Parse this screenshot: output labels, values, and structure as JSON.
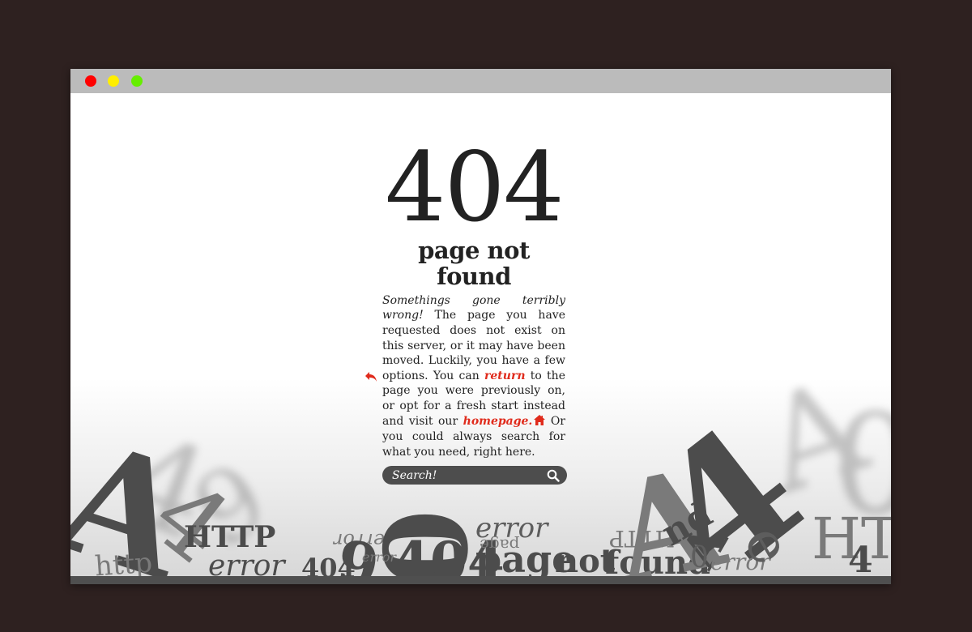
{
  "window": {
    "controls": {
      "close_color": "#ff0000",
      "minimize_color": "#ffee00",
      "maximize_color": "#66ee00"
    }
  },
  "error": {
    "code": "404",
    "title": "page not found",
    "lead": "Somethings gone terribly wrong!",
    "body_part1": " The page you have requested does not exist on this server, or it may have been moved. Luckily, you have a few options. You can ",
    "return_link": "return",
    "body_part2": " to the page you were previously on, or opt for a fresh start instead and visit our ",
    "homepage_link": "homepage.",
    "body_part3": " Or you could always search for what you need, right here."
  },
  "search": {
    "placeholder": "Search!"
  },
  "icons": {
    "return": "return-arrow-icon",
    "home": "home-icon",
    "search": "search-icon"
  },
  "colors": {
    "link": "#e02b1c",
    "background": "#2e2120",
    "titlebar": "#bbbbbb",
    "debris": "#4c4c4c"
  },
  "debris_words": {
    "http": "HTTP",
    "error": "error",
    "code": "404",
    "page": "page",
    "not": "not",
    "found": "found",
    "letter_a": "A",
    "ht": "HT",
    "four": "4",
    "nine": "9",
    "zero": "0",
    "nd": "nd",
    "small_http": "http",
    "small_e": "e"
  }
}
